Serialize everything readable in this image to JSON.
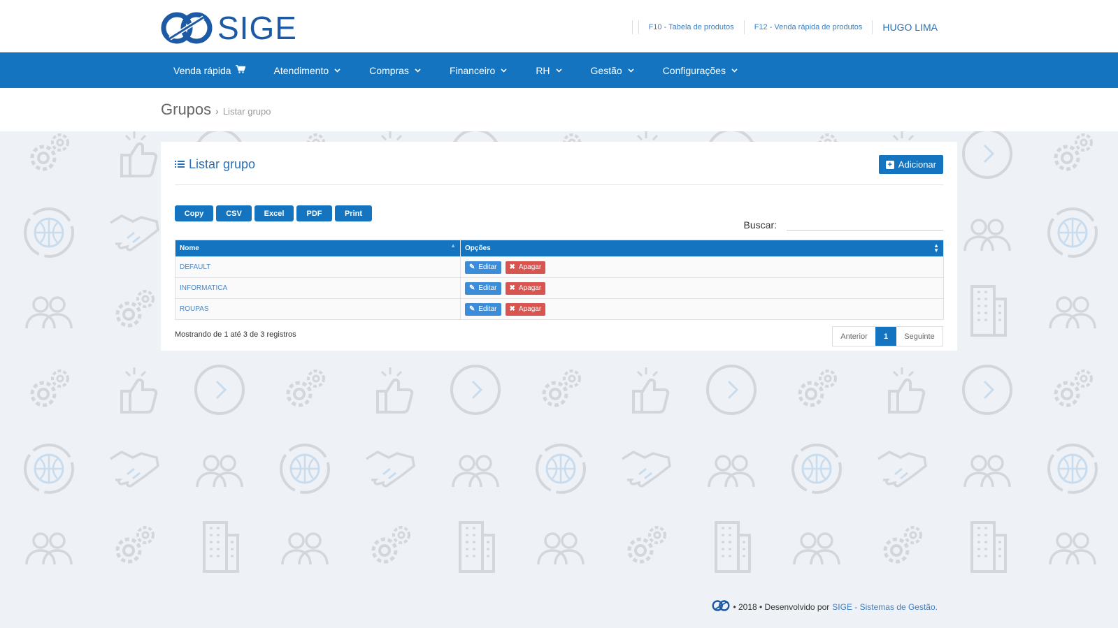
{
  "brand": {
    "name": "SIGE",
    "color": "#1c5aa6"
  },
  "toplinks": {
    "link1": "F10 - Tabela de produtos",
    "link2": "F12 - Venda rápida de produtos",
    "user": "HUGO LIMA"
  },
  "nav": {
    "items": [
      {
        "label": "Venda rápida",
        "icon": "cart-icon"
      },
      {
        "label": "Atendimento",
        "icon": "chevron-down-icon"
      },
      {
        "label": "Compras",
        "icon": "chevron-down-icon"
      },
      {
        "label": "Financeiro",
        "icon": "chevron-down-icon"
      },
      {
        "label": "RH",
        "icon": "chevron-down-icon"
      },
      {
        "label": "Gestão",
        "icon": "chevron-down-icon"
      },
      {
        "label": "Configurações",
        "icon": "chevron-down-icon"
      }
    ]
  },
  "breadcrumb": {
    "title": "Grupos",
    "separator": "›",
    "current": "Listar grupo"
  },
  "card": {
    "title": "Listar grupo",
    "add_label": "Adicionar",
    "export_buttons": [
      "Copy",
      "CSV",
      "Excel",
      "PDF",
      "Print"
    ],
    "search_label": "Buscar:",
    "search_value": ""
  },
  "table": {
    "columns": [
      "Nome",
      "Opções"
    ],
    "rows": [
      {
        "nome": "DEFAULT",
        "edit": "Editar",
        "delete": "Apagar"
      },
      {
        "nome": "INFORMATICA",
        "edit": "Editar",
        "delete": "Apagar"
      },
      {
        "nome": "ROUPAS",
        "edit": "Editar",
        "delete": "Apagar"
      }
    ]
  },
  "info": "Mostrando de 1 até 3 de 3 registros",
  "pager": {
    "prev": "Anterior",
    "current": "1",
    "next": "Seguinte"
  },
  "footer": {
    "text": "• 2018 • Desenvolvido por",
    "link": "SIGE - Sistemas de Gestão."
  },
  "colors": {
    "primary": "#1474bf",
    "danger": "#d9534f",
    "edit": "#3c8dd9",
    "background": "#eef1f5"
  }
}
